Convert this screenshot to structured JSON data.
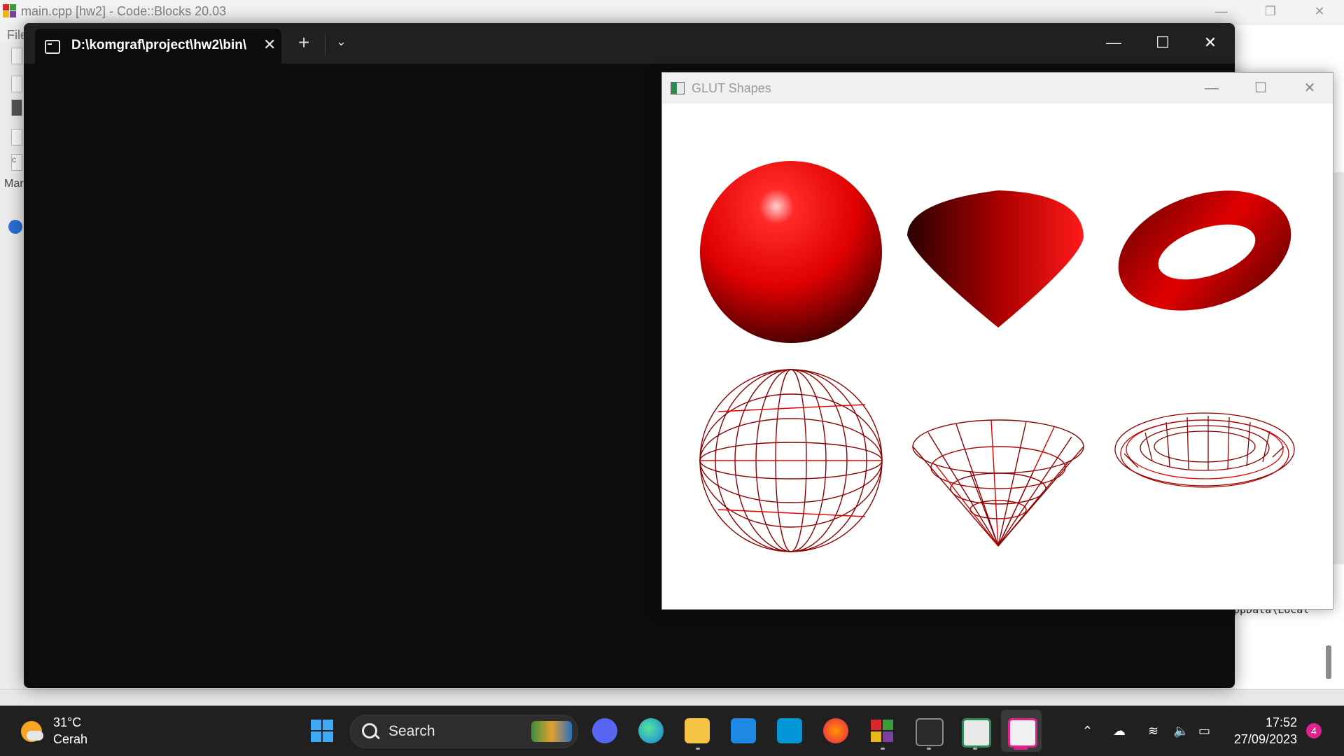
{
  "codeblocks": {
    "title": "main.cpp [hw2] - Code::Blocks 20.03",
    "menu_file": "File",
    "left_label": "Man",
    "left_text": "c",
    "log_text": "ppData\\Local"
  },
  "terminal": {
    "tab_title": "D:\\komgraf\\project\\hw2\\bin\\",
    "new_tab": "+",
    "dropdown": "⌄",
    "tab_close": "✕",
    "minimize": "—",
    "maximize": "☐",
    "close": "✕"
  },
  "glut": {
    "title": "GLUT Shapes",
    "minimize": "—",
    "maximize": "☐",
    "close": "✕",
    "shapes": [
      {
        "name": "solid-sphere",
        "style": "solid"
      },
      {
        "name": "solid-cone",
        "style": "solid"
      },
      {
        "name": "solid-torus",
        "style": "solid"
      },
      {
        "name": "wire-sphere",
        "style": "wire"
      },
      {
        "name": "wire-cone",
        "style": "wire"
      },
      {
        "name": "wire-torus",
        "style": "wire"
      }
    ],
    "color": "#ff0000"
  },
  "taskbar": {
    "weather_temp": "31°C",
    "weather_desc": "Cerah",
    "search_placeholder": "Search",
    "clock_time": "17:52",
    "clock_date": "27/09/2023",
    "notification_count": "4",
    "apps": [
      "start",
      "search",
      "discord",
      "edge",
      "file-explorer",
      "mail",
      "myhp",
      "firefox",
      "codeblocks",
      "terminal",
      "glut-app",
      "snipping-tool"
    ]
  }
}
